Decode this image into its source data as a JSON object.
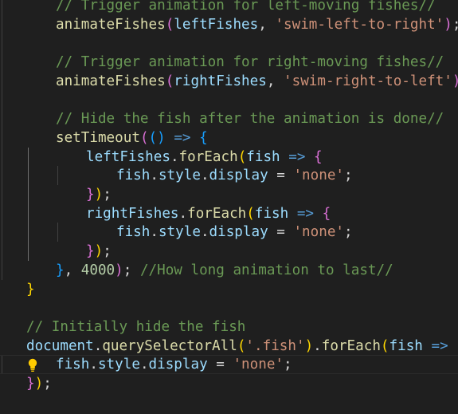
{
  "editor": {
    "lines": [
      {
        "indent": 2,
        "tokens": [
          {
            "c": "cm",
            "t": "// Trigger animation for left-moving fishes//"
          }
        ]
      },
      {
        "indent": 2,
        "tokens": [
          {
            "c": "fn",
            "t": "animateFishes"
          },
          {
            "c": "b2",
            "t": "("
          },
          {
            "c": "var",
            "t": "leftFishes"
          },
          {
            "c": "op",
            "t": ", "
          },
          {
            "c": "str",
            "t": "'swim-left-to-right'"
          },
          {
            "c": "b2",
            "t": ")"
          },
          {
            "c": "op",
            "t": ";"
          }
        ]
      },
      {
        "indent": 0,
        "tokens": []
      },
      {
        "indent": 2,
        "tokens": [
          {
            "c": "cm",
            "t": "// Trigger animation for right-moving fishes//"
          }
        ]
      },
      {
        "indent": 2,
        "tokens": [
          {
            "c": "fn",
            "t": "animateFishes"
          },
          {
            "c": "b2",
            "t": "("
          },
          {
            "c": "var",
            "t": "rightFishes"
          },
          {
            "c": "op",
            "t": ", "
          },
          {
            "c": "str",
            "t": "'swim-right-to-left'"
          },
          {
            "c": "b2",
            "t": ")"
          },
          {
            "c": "op",
            "t": ";"
          }
        ]
      },
      {
        "indent": 0,
        "tokens": []
      },
      {
        "indent": 2,
        "tokens": [
          {
            "c": "cm",
            "t": "// Hide the fish after the animation is done//"
          }
        ]
      },
      {
        "indent": 2,
        "tokens": [
          {
            "c": "fn",
            "t": "setTimeout"
          },
          {
            "c": "b2",
            "t": "("
          },
          {
            "c": "b3",
            "t": "()"
          },
          {
            "c": "op",
            "t": " "
          },
          {
            "c": "kw",
            "t": "=>"
          },
          {
            "c": "op",
            "t": " "
          },
          {
            "c": "b3",
            "t": "{"
          }
        ]
      },
      {
        "indent": 3,
        "tokens": [
          {
            "c": "var",
            "t": "leftFishes"
          },
          {
            "c": "op",
            "t": "."
          },
          {
            "c": "fn",
            "t": "forEach"
          },
          {
            "c": "b1",
            "t": "("
          },
          {
            "c": "var",
            "t": "fish"
          },
          {
            "c": "op",
            "t": " "
          },
          {
            "c": "kw",
            "t": "=>"
          },
          {
            "c": "op",
            "t": " "
          },
          {
            "c": "b2",
            "t": "{"
          }
        ]
      },
      {
        "indent": 4,
        "tokens": [
          {
            "c": "var",
            "t": "fish"
          },
          {
            "c": "op",
            "t": "."
          },
          {
            "c": "var",
            "t": "style"
          },
          {
            "c": "op",
            "t": "."
          },
          {
            "c": "var",
            "t": "display"
          },
          {
            "c": "op",
            "t": " = "
          },
          {
            "c": "str",
            "t": "'none'"
          },
          {
            "c": "op",
            "t": ";"
          }
        ]
      },
      {
        "indent": 3,
        "tokens": [
          {
            "c": "b2",
            "t": "}"
          },
          {
            "c": "b1",
            "t": ")"
          },
          {
            "c": "op",
            "t": ";"
          }
        ]
      },
      {
        "indent": 3,
        "tokens": [
          {
            "c": "var",
            "t": "rightFishes"
          },
          {
            "c": "op",
            "t": "."
          },
          {
            "c": "fn",
            "t": "forEach"
          },
          {
            "c": "b1",
            "t": "("
          },
          {
            "c": "var",
            "t": "fish"
          },
          {
            "c": "op",
            "t": " "
          },
          {
            "c": "kw",
            "t": "=>"
          },
          {
            "c": "op",
            "t": " "
          },
          {
            "c": "b2",
            "t": "{"
          }
        ]
      },
      {
        "indent": 4,
        "tokens": [
          {
            "c": "var",
            "t": "fish"
          },
          {
            "c": "op",
            "t": "."
          },
          {
            "c": "var",
            "t": "style"
          },
          {
            "c": "op",
            "t": "."
          },
          {
            "c": "var",
            "t": "display"
          },
          {
            "c": "op",
            "t": " = "
          },
          {
            "c": "str",
            "t": "'none'"
          },
          {
            "c": "op",
            "t": ";"
          }
        ]
      },
      {
        "indent": 3,
        "tokens": [
          {
            "c": "b2",
            "t": "}"
          },
          {
            "c": "b1",
            "t": ")"
          },
          {
            "c": "op",
            "t": ";"
          }
        ]
      },
      {
        "indent": 2,
        "tokens": [
          {
            "c": "b3",
            "t": "}"
          },
          {
            "c": "op",
            "t": ", "
          },
          {
            "c": "num",
            "t": "4000"
          },
          {
            "c": "b2",
            "t": ")"
          },
          {
            "c": "op",
            "t": "; "
          },
          {
            "c": "cm",
            "t": "//How long animation to last//"
          }
        ]
      },
      {
        "indent": 1,
        "tokens": [
          {
            "c": "b1",
            "t": "}"
          }
        ]
      },
      {
        "indent": 0,
        "tokens": []
      },
      {
        "indent": 1,
        "tokens": [
          {
            "c": "cm",
            "t": "// Initially hide the fish"
          }
        ]
      },
      {
        "indent": 1,
        "tokens": [
          {
            "c": "var",
            "t": "document"
          },
          {
            "c": "op",
            "t": "."
          },
          {
            "c": "fn",
            "t": "querySelectorAll"
          },
          {
            "c": "b1",
            "t": "("
          },
          {
            "c": "str",
            "t": "'.fish'"
          },
          {
            "c": "b1",
            "t": ")"
          },
          {
            "c": "op",
            "t": "."
          },
          {
            "c": "fn",
            "t": "forEach"
          },
          {
            "c": "b1",
            "t": "("
          },
          {
            "c": "var",
            "t": "fish"
          },
          {
            "c": "op",
            "t": " "
          },
          {
            "c": "kw",
            "t": "=>"
          },
          {
            "c": "op",
            "t": " "
          },
          {
            "c": "b2",
            "t": "{"
          }
        ]
      },
      {
        "indent": 2,
        "current": true,
        "lightbulb": true,
        "tokens": [
          {
            "c": "var",
            "t": "fish"
          },
          {
            "c": "op",
            "t": "."
          },
          {
            "c": "var",
            "t": "style"
          },
          {
            "c": "op",
            "t": "."
          },
          {
            "c": "var",
            "t": "display"
          },
          {
            "c": "op",
            "t": " = "
          },
          {
            "c": "str",
            "t": "'none'"
          },
          {
            "c": "op",
            "t": ";"
          }
        ]
      },
      {
        "indent": 1,
        "tokens": [
          {
            "c": "b2",
            "t": "}"
          },
          {
            "c": "b1",
            "t": ")"
          },
          {
            "c": "op",
            "t": ";"
          }
        ]
      }
    ]
  },
  "icons": {
    "lightbulb": "lightbulb-icon"
  },
  "colors": {
    "background": "#1f1f1f",
    "comment": "#6a9955",
    "function": "#dcdcaa",
    "variable": "#9cdcfe",
    "string": "#ce9178",
    "number": "#b5cea8",
    "keyword": "#569cd6",
    "bracket_gold": "#ffd700",
    "bracket_orchid": "#da70d6",
    "bracket_blue": "#179fff"
  }
}
